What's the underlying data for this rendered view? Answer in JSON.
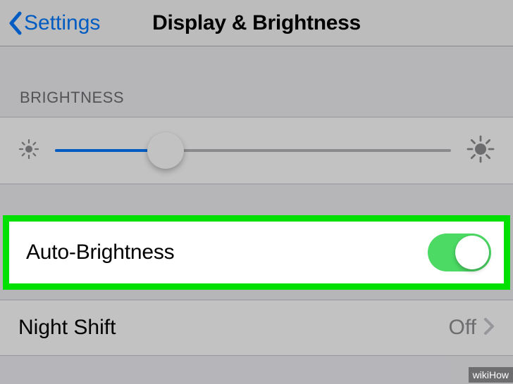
{
  "nav": {
    "back_label": "Settings",
    "title": "Display & Brightness"
  },
  "section": {
    "brightness_header": "BRIGHTNESS"
  },
  "slider": {
    "percent": 28
  },
  "auto_brightness": {
    "label": "Auto-Brightness",
    "on": true
  },
  "night_shift": {
    "label": "Night Shift",
    "value": "Off"
  },
  "watermark": "wikiHow"
}
